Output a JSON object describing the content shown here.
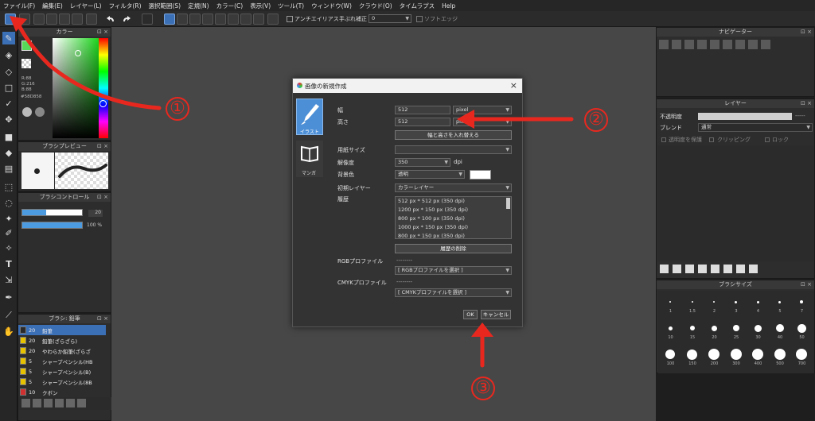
{
  "menu": [
    "ファイル(F)",
    "編集(E)",
    "レイヤー(L)",
    "フィルタ(R)",
    "選択範囲(S)",
    "定規(N)",
    "カラー(C)",
    "表示(V)",
    "ツール(T)",
    "ウィンドウ(W)",
    "クラウド(O)",
    "タイムラプス",
    "Help"
  ],
  "toolbar": {
    "antialias_label": "アンチエイリアス",
    "stabilizer_label": "手ぶれ補正",
    "stabilizer_value": "0",
    "softedge_label": "ソフトエッジ"
  },
  "color_panel": {
    "title": "カラー",
    "r": "R:88",
    "g": "G:216",
    "b": "B:88",
    "hex": "#58D858",
    "accent": "#58d858"
  },
  "brush_preview": {
    "title": "ブラシプレビュー"
  },
  "brush_control": {
    "title": "ブラシコントロール",
    "size": "20",
    "opacity": "100 %"
  },
  "brush_list": {
    "title": "ブラシ: 鉛筆",
    "items": [
      {
        "size": "20",
        "name": "鉛筆",
        "color": "#2a2a2a",
        "selected": true
      },
      {
        "size": "20",
        "name": "鉛筆(ざらざら)",
        "color": "#e6c200"
      },
      {
        "size": "20",
        "name": "やわらか鉛筆(ざらざ",
        "color": "#e6c200"
      },
      {
        "size": "5",
        "name": "シャープペンシル(HB",
        "color": "#e6c200"
      },
      {
        "size": "5",
        "name": "シャープペンシル(B)",
        "color": "#e6c200"
      },
      {
        "size": "5",
        "name": "シャープペンシル(8B",
        "color": "#e6c200"
      },
      {
        "size": "10",
        "name": "クボン",
        "color": "#d03030"
      }
    ]
  },
  "navigator": {
    "title": "ナビゲーター"
  },
  "layer_panel": {
    "title": "レイヤー",
    "opacity_label": "不透明度",
    "opacity_value": "-----",
    "blend_label": "ブレンド",
    "blend_value": "通常",
    "protect_label": "透明度を保護",
    "clipping_label": "クリッピング",
    "lock_label": "ロック"
  },
  "brush_size": {
    "title": "ブラシサイズ",
    "row1": [
      "1",
      "1.5",
      "2",
      "3",
      "4",
      "5",
      "7"
    ],
    "row2": [
      "10",
      "15",
      "20",
      "25",
      "30",
      "40",
      "50"
    ],
    "row3": [
      "100",
      "150",
      "200",
      "300",
      "400",
      "500",
      "700"
    ]
  },
  "dialog": {
    "title": "画像の新規作成",
    "tab_illust": "イラスト",
    "tab_manga": "マンガ",
    "width_label": "幅",
    "width_value": "512",
    "height_label": "高さ",
    "height_value": "512",
    "unit_px": "pixel",
    "swap_button": "幅と高さを入れ替える",
    "paper_label": "用紙サイズ",
    "resolution_label": "解像度",
    "resolution_value": "350",
    "dpi": "dpi",
    "bg_label": "背景色",
    "bg_value": "透明",
    "initial_layer_label": "初期レイヤー",
    "initial_layer_value": "カラーレイヤー",
    "history_label": "履歴",
    "history": [
      "512 px * 512 px (350 dpi)",
      "1200 px * 150 px (350 dpi)",
      "800 px * 100 px (350 dpi)",
      "1000 px * 150 px (350 dpi)",
      "800 px * 150 px (350 dpi)"
    ],
    "delete_history": "履歴の削除",
    "rgb_label": "RGBプロファイル",
    "rgb_value": "--------",
    "rgb_select": "[ RGBプロファイルを選択 ]",
    "cmyk_label": "CMYKプロファイル",
    "cmyk_value": "--------",
    "cmyk_select": "[ CMYKプロファイルを選択 ]",
    "ok": "OK",
    "cancel": "キャンセル"
  },
  "annotations": {
    "one": "①",
    "two": "②",
    "three": "③",
    "color": "#e8281f"
  }
}
